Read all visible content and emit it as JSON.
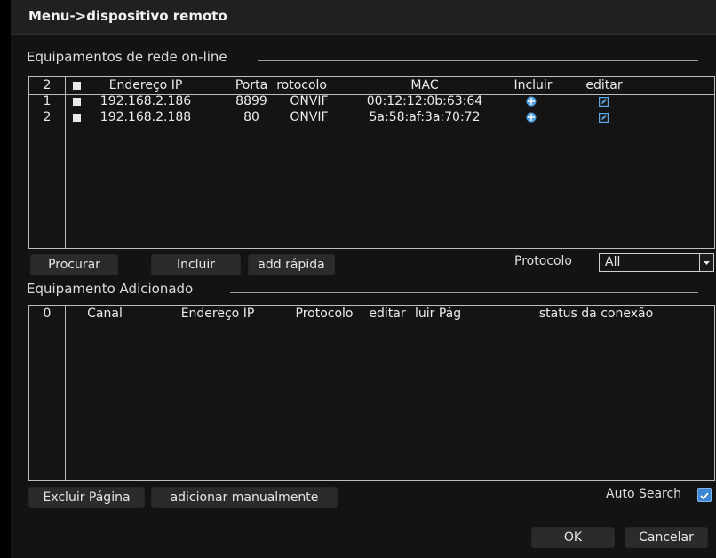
{
  "title": "Menu->dispositivo remoto",
  "online": {
    "section_label": "Equipamentos de rede on-line",
    "count": "2",
    "headers": {
      "ip": "Endereço IP",
      "port": "Porta",
      "protocol": "Protocolo",
      "mac": "MAC",
      "include": "Incluir",
      "edit": "editar"
    },
    "rows": [
      {
        "num": "1",
        "ip": "192.168.2.186",
        "port": "8899",
        "protocol": "ONVIF",
        "mac": "00:12:12:0b:63:64"
      },
      {
        "num": "2",
        "ip": "192.168.2.188",
        "port": "80",
        "protocol": "ONVIF",
        "mac": "5a:58:af:3a:70:72"
      }
    ],
    "buttons": {
      "search": "Procurar",
      "include": "Incluir",
      "quick_add": "add rápida"
    },
    "protocol_label": "Protocolo",
    "protocol_value": "All"
  },
  "added": {
    "section_label": "Equipamento Adicionado",
    "count": "0",
    "headers": {
      "channel": "Canal",
      "ip": "Endereço IP",
      "protocol": "Protocolo",
      "edit": "editar",
      "delete_page": "luir Pág",
      "status": "status da conexão"
    },
    "buttons": {
      "delete_page": "Excluir Página",
      "manual_add": "adicionar manualmente"
    }
  },
  "auto_search": {
    "label": "Auto Search",
    "checked": true
  },
  "footer": {
    "ok": "OK",
    "cancel": "Cancelar"
  },
  "colors": {
    "icon_blue": "#5aa9ea",
    "checkbox": "#3d86d6"
  }
}
